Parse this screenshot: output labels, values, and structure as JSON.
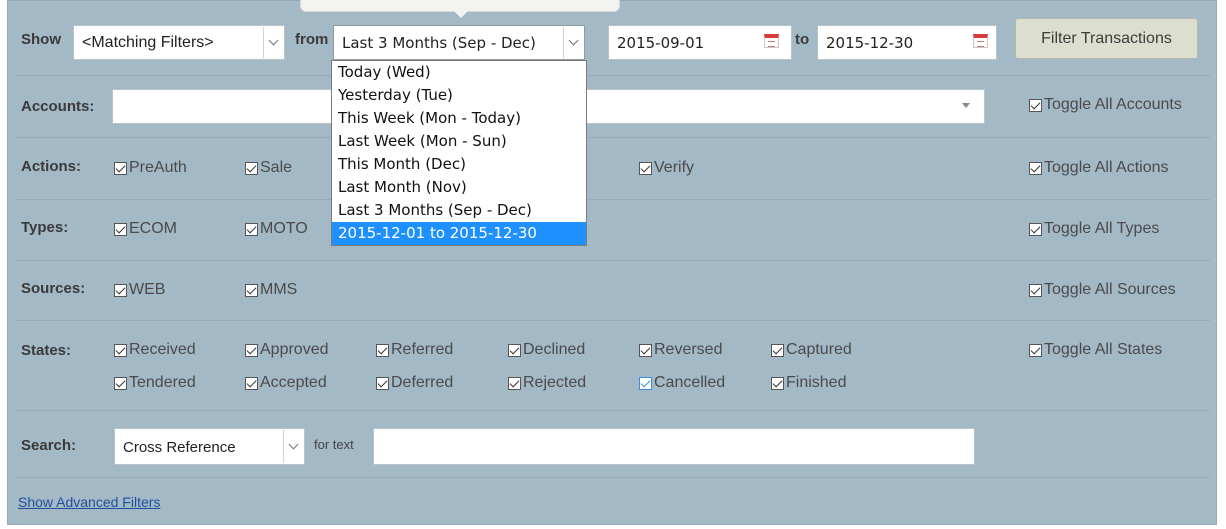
{
  "filters": {
    "show_label": "Show",
    "show_select": "<Matching Filters>",
    "from_label": "from",
    "period_select": "Last 3 Months (Sep - Dec)",
    "date_from": "2015-09-01",
    "to_label": "to",
    "date_to": "2015-12-30",
    "filter_button": "Filter Transactions"
  },
  "period_options": [
    {
      "label": "Today (Wed)",
      "selected": false
    },
    {
      "label": "Yesterday (Tue)",
      "selected": false
    },
    {
      "label": "This Week (Mon - Today)",
      "selected": false
    },
    {
      "label": "Last Week (Mon - Sun)",
      "selected": false
    },
    {
      "label": "This Month (Dec)",
      "selected": false
    },
    {
      "label": "Last Month (Nov)",
      "selected": false
    },
    {
      "label": "Last 3 Months (Sep - Dec)",
      "selected": false
    },
    {
      "label": "2015-12-01 to 2015-12-30",
      "selected": true
    }
  ],
  "accounts": {
    "label": "Accounts:",
    "toggle": "Toggle All Accounts"
  },
  "actions": {
    "label": "Actions:",
    "items": [
      "PreAuth",
      "Sale",
      "Verify"
    ],
    "toggle": "Toggle All Actions"
  },
  "types": {
    "label": "Types:",
    "items": [
      "ECOM",
      "MOTO"
    ],
    "toggle": "Toggle All Types"
  },
  "sources": {
    "label": "Sources:",
    "items": [
      "WEB",
      "MMS"
    ],
    "toggle": "Toggle All Sources"
  },
  "states": {
    "label": "States:",
    "row1": [
      "Received",
      "Approved",
      "Referred",
      "Declined",
      "Reversed",
      "Captured"
    ],
    "row2": [
      "Tendered",
      "Accepted",
      "Deferred",
      "Rejected",
      "Cancelled",
      "Finished"
    ],
    "toggle": "Toggle All States"
  },
  "search": {
    "label": "Search:",
    "field_select": "Cross Reference",
    "for_text_label": "for text",
    "text_value": ""
  },
  "advanced_link": "Show Advanced Filters",
  "colors": {
    "panel_bg": "#a4b9c6",
    "selected_option": "#1e90ff",
    "link": "#1f4f9a"
  }
}
